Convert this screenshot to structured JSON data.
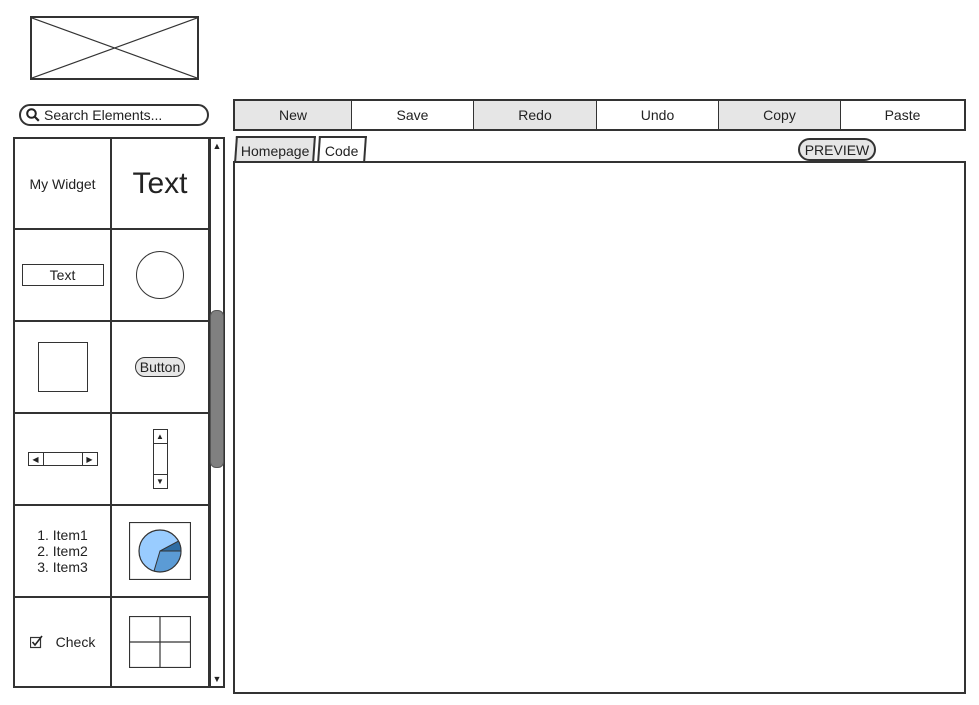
{
  "search": {
    "placeholder": "Search Elements..."
  },
  "toolbar": {
    "buttons": [
      {
        "label": "New",
        "shaded": true
      },
      {
        "label": "Save",
        "shaded": false
      },
      {
        "label": "Redo",
        "shaded": true
      },
      {
        "label": "Undo",
        "shaded": false
      },
      {
        "label": "Copy",
        "shaded": true
      },
      {
        "label": "Paste",
        "shaded": false
      }
    ]
  },
  "palette": {
    "my_widget": "My Widget",
    "big_text": "Text",
    "text_input": "Text",
    "button": "Button",
    "list_items": [
      "1. Item1",
      "2. Item2",
      "3. Item3"
    ],
    "check": "Check",
    "icons": [
      "circle-shape-icon",
      "square-shape-icon",
      "horizontal-scrollbar-icon",
      "vertical-scrollbar-icon",
      "pie-chart-icon",
      "grid-table-icon",
      "checkbox-icon"
    ]
  },
  "tabs": {
    "homepage": "Homepage",
    "code": "Code"
  },
  "preview_label": "PREVIEW",
  "colors": {
    "shaded": "#e6e6e6",
    "border": "#333333",
    "pie_light": "#99ccff",
    "pie_mid": "#5b9bd5",
    "pie_dark": "#2e6da4",
    "scroll_thumb": "#808080"
  }
}
